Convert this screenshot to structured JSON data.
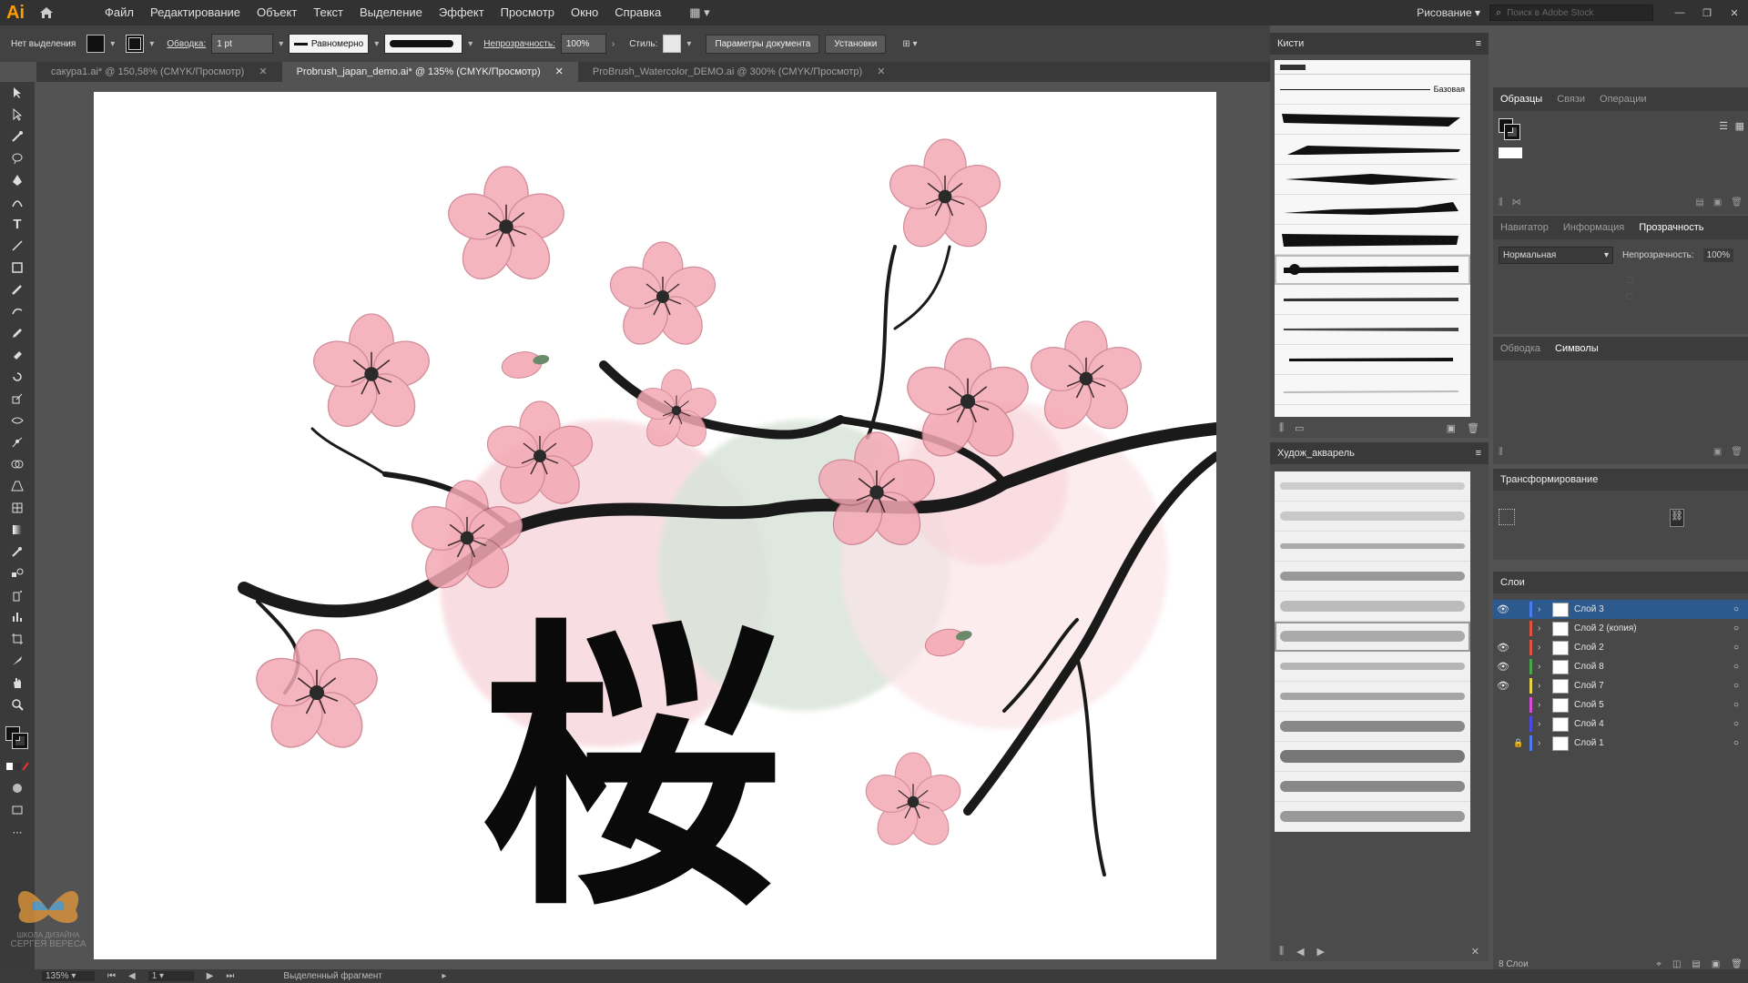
{
  "app": {
    "logo": "Ai",
    "workspace": "Рисование",
    "search_placeholder": "Поиск в Adobe Stock"
  },
  "menu": [
    "Файл",
    "Редактирование",
    "Объект",
    "Текст",
    "Выделение",
    "Эффект",
    "Просмотр",
    "Окно",
    "Справка"
  ],
  "control": {
    "no_selection": "Нет выделения",
    "stroke_label": "Обводка:",
    "stroke_weight": "1 pt",
    "profile": "Равномерно",
    "opacity_label": "Непрозрачность:",
    "opacity_value": "100%",
    "style_label": "Стиль:",
    "doc_params": "Параметры документа",
    "settings": "Установки"
  },
  "tabs": [
    {
      "label": "сакура1.ai* @ 150,58% (CMYK/Просмотр)",
      "active": false
    },
    {
      "label": "Probrush_japan_demo.ai* @ 135% (CMYK/Просмотр)",
      "active": true
    },
    {
      "label": "ProBrush_Watercolor_DEMO.ai @ 300% (CMYK/Просмотр)",
      "active": false
    }
  ],
  "brushes_panel": {
    "title": "Кисти",
    "basic_label": "Базовая"
  },
  "watercolor_panel": {
    "title": "Худож_акварель"
  },
  "swatches_panel": {
    "tabs": [
      "Образцы",
      "Связи",
      "Операции"
    ]
  },
  "nav_panel": {
    "tabs": [
      "Навигатор",
      "Информация",
      "Прозрачность"
    ],
    "blend_mode": "Нормальная",
    "opacity_label": "Непрозрачность:",
    "opacity_value": "100%"
  },
  "stroke_panel": {
    "tabs": [
      "Обводка",
      "Символы"
    ]
  },
  "transform_panel": {
    "title": "Трансформирование"
  },
  "layers_panel": {
    "title": "Слои",
    "layers": [
      {
        "name": "Слой 3",
        "color": "#4a7cf0",
        "visible": true,
        "selected": true,
        "locked": false
      },
      {
        "name": "Слой 2 (копия)",
        "color": "#e0533f",
        "visible": false,
        "selected": false,
        "locked": false
      },
      {
        "name": "Слой 2",
        "color": "#e0533f",
        "visible": true,
        "selected": false,
        "locked": false
      },
      {
        "name": "Слой 8",
        "color": "#4aa64a",
        "visible": true,
        "selected": false,
        "locked": false
      },
      {
        "name": "Слой 7",
        "color": "#e8d44a",
        "visible": true,
        "selected": false,
        "locked": false
      },
      {
        "name": "Слой 5",
        "color": "#d84ad8",
        "visible": false,
        "selected": false,
        "locked": false
      },
      {
        "name": "Слой 4",
        "color": "#4a4ae8",
        "visible": false,
        "selected": false,
        "locked": false
      },
      {
        "name": "Слой 1",
        "color": "#4a7cf0",
        "visible": false,
        "selected": false,
        "locked": true
      }
    ],
    "count": "8 Слои"
  },
  "artwork": {
    "kanji": "桜",
    "watermark_line1": "ШКОЛА ДИЗАЙНА",
    "watermark_line2": "СЕРГЕЯ ВЕРЕСА"
  },
  "status": {
    "zoom": "135%",
    "page": "1",
    "info": "Выделенный фрагмент"
  }
}
